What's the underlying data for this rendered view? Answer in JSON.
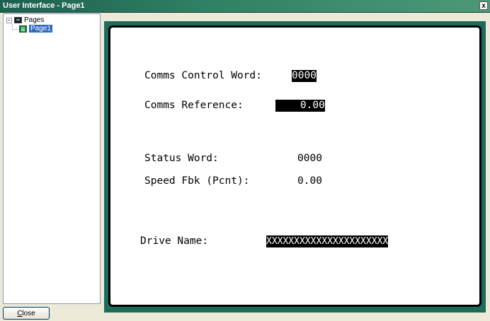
{
  "window": {
    "title": "User Interface - Page1",
    "close_glyph": "x"
  },
  "tree": {
    "root": {
      "label": "Pages",
      "expander": "−",
      "icon": "pages-icon"
    },
    "children": [
      {
        "label": "Page1",
        "icon": "page-icon",
        "selected": true
      }
    ]
  },
  "footer": {
    "close_button_first": "C",
    "close_button_rest": "lose"
  },
  "page": {
    "comms_control_word": {
      "label": "Comms Control Word:",
      "value": "0000"
    },
    "comms_reference": {
      "label": "Comms Reference:",
      "value": "    0.00"
    },
    "status_word": {
      "label": "Status Word:",
      "value": "0000"
    },
    "speed_fbk": {
      "label": "Speed Fbk (Pcnt):",
      "value": "0.00"
    },
    "drive_name": {
      "label": "Drive Name:",
      "value": "XXXXXXXXXXXXXXXXXXXXXX"
    }
  },
  "colors": {
    "frame": "#1d6b5b",
    "title_bar": "#2e7f63",
    "selection": "#316ac5"
  }
}
